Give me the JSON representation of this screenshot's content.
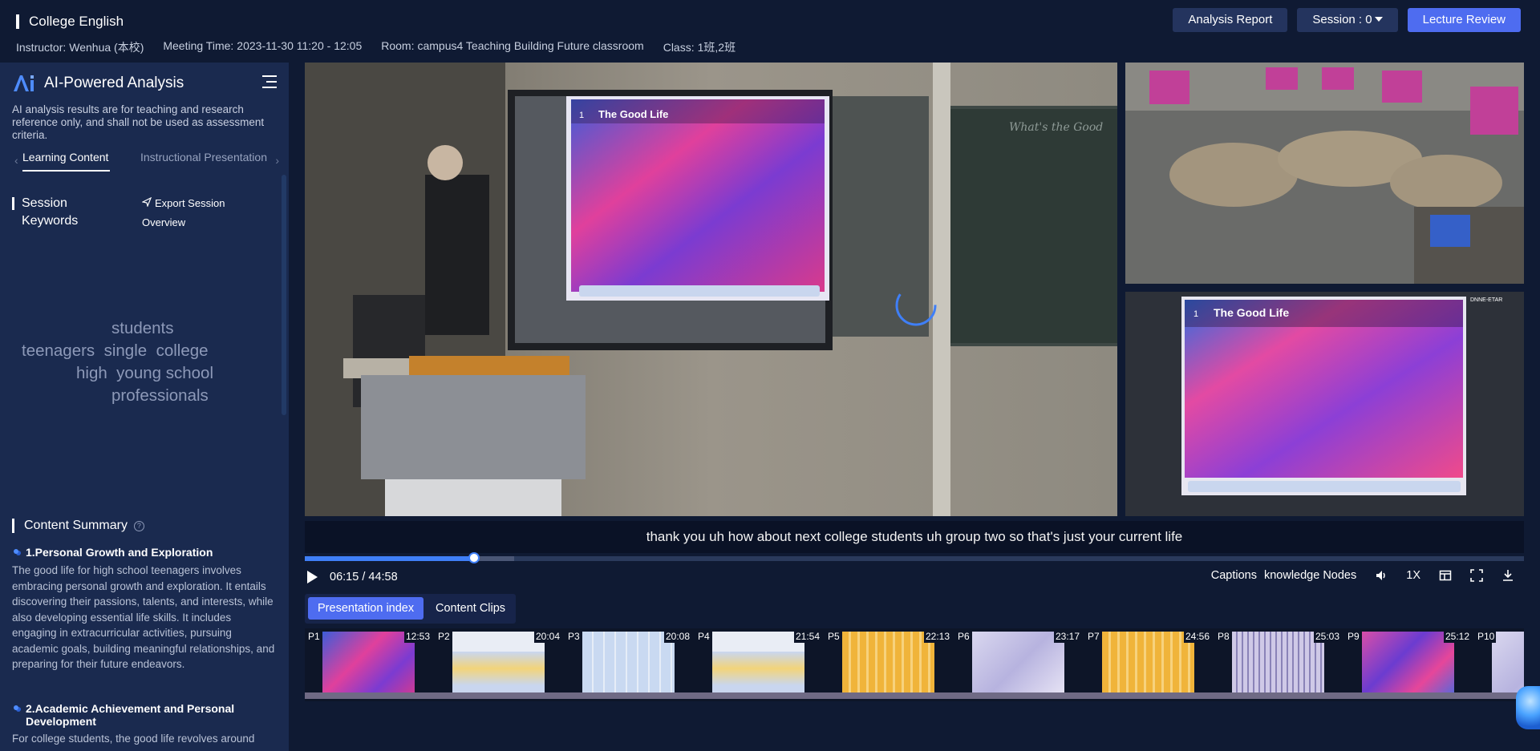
{
  "header": {
    "course_title": "College English",
    "instructor_label": "Instructor:",
    "instructor_value": "Wenhua (本校)",
    "meeting_label": "Meeting Time:",
    "meeting_value": "2023-11-30 11:20 - 12:05",
    "room_label": "Room:",
    "room_value": "campus4 Teaching Building Future classroom",
    "class_label": "Class:",
    "class_value": "1班,2班",
    "buttons": {
      "analysis_report": "Analysis Report",
      "session": "Session : 0",
      "lecture_review": "Lecture Review"
    }
  },
  "sidebar": {
    "title": "AI-Powered Analysis",
    "disclaimer": "AI analysis results are for teaching and research reference only, and shall not be used as assessment criteria.",
    "tabs": [
      "Learning Content",
      "Instructional Presentation"
    ],
    "keywords_heading": "Session Keywords",
    "export_label": "Export Session Overview",
    "keywords": [
      [
        "students"
      ],
      [
        "teenagers",
        "single",
        "college"
      ],
      [
        "high",
        "young",
        "school"
      ],
      [
        "professionals"
      ]
    ],
    "summary_heading": "Content Summary",
    "summary": [
      {
        "title": "1.Personal Growth and Exploration",
        "body": "The good life for high school teenagers involves embracing personal growth and exploration. It entails discovering their passions, talents, and interests, while also developing essential life skills. It includes engaging in extracurricular activities, pursuing academic goals, building meaningful relationships, and preparing for their future endeavors."
      },
      {
        "title": "2.Academic Achievement and Personal Development",
        "body": "For college students, the good life revolves around"
      }
    ]
  },
  "player": {
    "slide_title": "The Good Life",
    "slide_number": "1",
    "board_text": "What's the Good",
    "panel_label": "DNNE-ETAR",
    "subtitle": "thank you uh how about next college students uh group two so that's just your current life",
    "current_time": "06:15",
    "total_time": "44:58",
    "progress": 0.139,
    "buffered_until": 0.172,
    "controls": [
      "Captions",
      "knowledge Nodes",
      "1X"
    ],
    "icons": [
      "volume-icon",
      "layout-icon",
      "fullscreen-icon",
      "download-icon"
    ]
  },
  "index_tabs": [
    "Presentation index",
    "Content Clips"
  ],
  "thumbnails": [
    {
      "page": "P1",
      "time": "12:53",
      "style": "art"
    },
    {
      "page": "P2",
      "time": "20:04",
      "style": "doc"
    },
    {
      "page": "P3",
      "time": "20:08",
      "style": "table"
    },
    {
      "page": "P4",
      "time": "21:54",
      "style": "doc"
    },
    {
      "page": "P5",
      "time": "22:13",
      "style": "orange"
    },
    {
      "page": "P6",
      "time": "23:17",
      "style": "light"
    },
    {
      "page": "P7",
      "time": "24:56",
      "style": "orange"
    },
    {
      "page": "P8",
      "time": "25:03",
      "style": "stripes"
    },
    {
      "page": "P9",
      "time": "25:12",
      "style": "art2"
    },
    {
      "page": "P10",
      "time": "",
      "style": "light"
    }
  ],
  "colors": {
    "background": "#0f1a33",
    "sidebar": "#1a2a4f",
    "accent": "#4e6cf0",
    "progress": "#3f7ff7"
  }
}
